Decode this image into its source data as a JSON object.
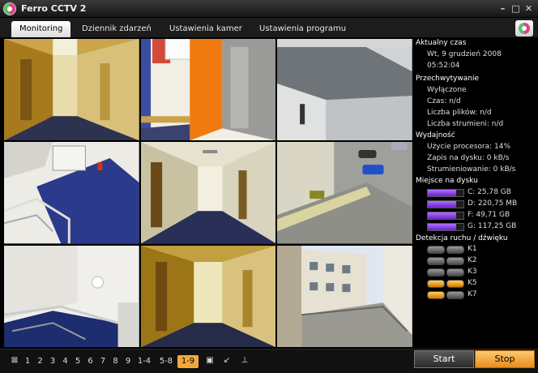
{
  "window": {
    "title": "Ferro CCTV 2",
    "controls": {
      "minimize": "–",
      "maximize": "□",
      "close": "✕"
    },
    "icons": {
      "app": "ferro-logo-icon"
    }
  },
  "tabs": [
    {
      "label": "Monitoring",
      "active": true
    },
    {
      "label": "Dziennik zdarzeń",
      "active": false
    },
    {
      "label": "Ustawienia kamer",
      "active": false
    },
    {
      "label": "Ustawienia programu",
      "active": false
    }
  ],
  "cameras": [
    {
      "id": 1,
      "scene": "corridor"
    },
    {
      "id": 2,
      "scene": "elevator-hall"
    },
    {
      "id": 3,
      "scene": "rooftop"
    },
    {
      "id": 4,
      "scene": "staircase"
    },
    {
      "id": 5,
      "scene": "corridor"
    },
    {
      "id": 6,
      "scene": "parking"
    },
    {
      "id": 7,
      "scene": "staircase-window"
    },
    {
      "id": 8,
      "scene": "corridor"
    },
    {
      "id": 9,
      "scene": "balcony-buildings"
    }
  ],
  "status": {
    "current_time": {
      "heading": "Aktualny czas",
      "date": "Wt, 9 grudzień 2008",
      "time": "05:52:04"
    },
    "recording": {
      "heading": "Przechwytywanie",
      "state": "Wyłączone",
      "time": "Czas: n/d",
      "files": "Liczba plików: n/d",
      "streams": "Liczba strumieni: n/d"
    },
    "performance": {
      "heading": "Wydajność",
      "cpu": "Użycie procesora: 14%",
      "disk_write": "Zapis na dysku: 0 kB/s",
      "stream": "Strumieniowanie: 0 kB/s"
    },
    "disk_space": {
      "heading": "Miejsce na dysku",
      "disks": [
        {
          "label": "C: 25,78 GB",
          "used_fraction": 0.8
        },
        {
          "label": "D: 220,75 MB",
          "used_fraction": 0.8
        },
        {
          "label": "F: 49,71 GB",
          "used_fraction": 0.8
        },
        {
          "label": "G: 117,25 GB",
          "used_fraction": 0.8
        }
      ]
    },
    "motion": {
      "heading": "Detekcja ruchu / dźwięku",
      "channels": [
        {
          "label": "K1",
          "motion": false,
          "sound": false
        },
        {
          "label": "K2",
          "motion": false,
          "sound": false
        },
        {
          "label": "K3",
          "motion": false,
          "sound": false
        },
        {
          "label": "K5",
          "motion": true,
          "sound": true
        },
        {
          "label": "K7",
          "motion": true,
          "sound": false
        }
      ]
    }
  },
  "bottombar": {
    "cams": [
      "1",
      "2",
      "3",
      "4",
      "5",
      "6",
      "7",
      "8",
      "9"
    ],
    "groups": [
      "1-4",
      "5-8",
      "1-9"
    ],
    "active_group": "1-9",
    "start_label": "Start",
    "stop_label": "Stop",
    "icons": [
      "fullscreen-icon",
      "layout-icon",
      "shrink-icon",
      "pin-icon"
    ]
  }
}
